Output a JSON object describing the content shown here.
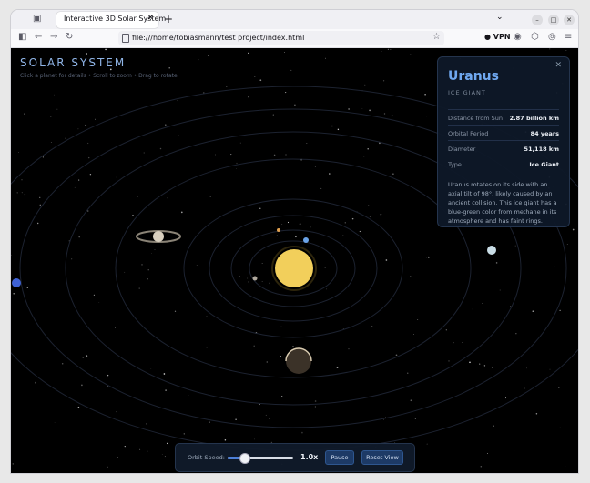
{
  "browser": {
    "tab_title": "Interactive 3D Solar System",
    "tab_close": "✕",
    "new_tab": "+",
    "url": "file:///home/tobiasmann/test project/index.html",
    "vpn_label": "VPN",
    "icons": [
      "tab-view-icon",
      "back-icon",
      "forward-icon",
      "reload-icon",
      "bookmark-star-icon",
      "account-icon",
      "extensions-icon",
      "menu-icon"
    ]
  },
  "app": {
    "title": "SOLAR SYSTEM",
    "subtitle": "Click a planet for details • Scroll to zoom • Drag to rotate"
  },
  "info_panel": {
    "close": "✕",
    "planet_name": "Uranus",
    "planet_class": "ICE GIANT",
    "rows": [
      {
        "key": "Distance from Sun",
        "value": "2.87 billion km"
      },
      {
        "key": "Orbital Period",
        "value": "84 years"
      },
      {
        "key": "Diameter",
        "value": "51,118 km"
      },
      {
        "key": "Type",
        "value": "Ice Giant"
      }
    ],
    "description": "Uranus rotates on its side with an axial tilt of 98°, likely caused by an ancient collision. This ice giant has a blue-green color from methane in its atmosphere and has faint rings."
  },
  "controls": {
    "orbit_speed_label": "Orbit Speed:",
    "speed_value": "1.0x",
    "speed_fraction": 0.25,
    "pause_label": "Pause",
    "reset_label": "Reset View"
  },
  "colors": {
    "background": "#000000",
    "sun": "#f2cf5b",
    "accent": "#6fa8f0",
    "panel": "#0e1828"
  }
}
